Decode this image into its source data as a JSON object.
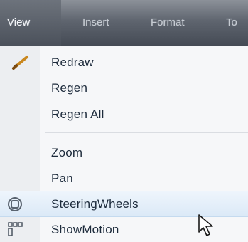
{
  "menubar": {
    "items": [
      {
        "label": "View",
        "active": true
      },
      {
        "label": "Insert",
        "active": false
      },
      {
        "label": "Format",
        "active": false
      },
      {
        "label": "To",
        "active": false
      }
    ]
  },
  "dropdown": {
    "items": [
      {
        "label": "Redraw",
        "icon": "pencil-icon"
      },
      {
        "label": "Regen",
        "icon": null
      },
      {
        "label": "Regen All",
        "icon": null
      },
      {
        "label": "Zoom",
        "icon": null
      },
      {
        "label": "Pan",
        "icon": null
      },
      {
        "label": "SteeringWheels",
        "icon": "steering-wheels-icon",
        "highlighted": true
      },
      {
        "label": "ShowMotion",
        "icon": "showmotion-icon"
      }
    ]
  },
  "colors": {
    "menubar_top": "#8c9199",
    "menubar_bottom": "#454b55",
    "menu_bg": "#f6f7f9",
    "item_text": "#1d2b3c",
    "hover_bg": "#dbe9f7"
  }
}
